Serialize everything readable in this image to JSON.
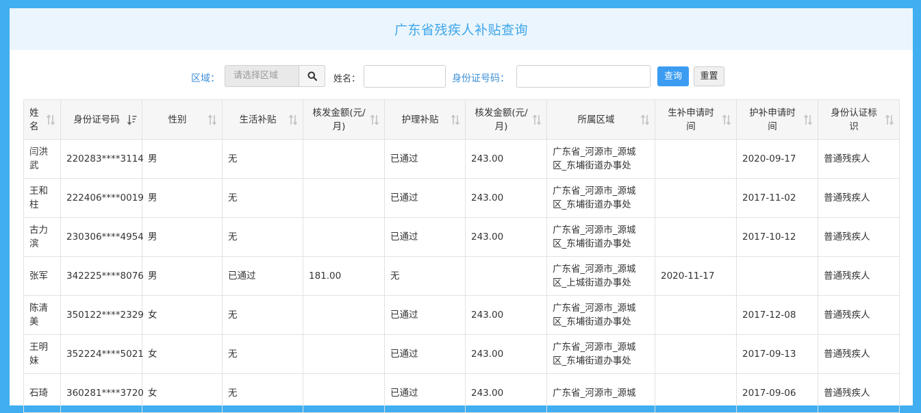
{
  "page": {
    "title": "广东省残疾人补贴查询"
  },
  "search": {
    "area_label": "区域：",
    "area_placeholder": "请选择区域",
    "name_label": "姓名：",
    "name_value": "",
    "id_label": "身份证号码：",
    "id_value": "",
    "query_button": "查询",
    "reset_button": "重置"
  },
  "table": {
    "headers": [
      {
        "line1": "姓",
        "line2": "名",
        "sort": "none"
      },
      {
        "line1": "身份证号码",
        "line2": "",
        "sort": "desc"
      },
      {
        "line1": "性别",
        "line2": "",
        "sort": "none"
      },
      {
        "line1": "生活补贴",
        "line2": "",
        "sort": "none"
      },
      {
        "line1": "核发金额(元/",
        "line2": "月)",
        "sort": "none"
      },
      {
        "line1": "护理补贴",
        "line2": "",
        "sort": "none"
      },
      {
        "line1": "核发金额(元/",
        "line2": "月)",
        "sort": "none"
      },
      {
        "line1": "所属区域",
        "line2": "",
        "sort": "none"
      },
      {
        "line1": "生补申请时",
        "line2": "间",
        "sort": "none"
      },
      {
        "line1": "护补申请时",
        "line2": "间",
        "sort": "none"
      },
      {
        "line1": "身份认证标",
        "line2": "识",
        "sort": "none"
      }
    ],
    "rows": [
      [
        [
          "闫洪",
          "武"
        ],
        [
          "220283****3114"
        ],
        [
          "男"
        ],
        [
          "无"
        ],
        [
          ""
        ],
        [
          "已通过"
        ],
        [
          "243.00"
        ],
        [
          "广东省_河源市_源城",
          "区_东埔街道办事处"
        ],
        [
          ""
        ],
        [
          "2020-09-17"
        ],
        [
          "普通残疾人"
        ]
      ],
      [
        [
          "王和",
          "柱"
        ],
        [
          "222406****0019"
        ],
        [
          "男"
        ],
        [
          "无"
        ],
        [
          ""
        ],
        [
          "已通过"
        ],
        [
          "243.00"
        ],
        [
          "广东省_河源市_源城",
          "区_东埔街道办事处"
        ],
        [
          ""
        ],
        [
          "2017-11-02"
        ],
        [
          "普通残疾人"
        ]
      ],
      [
        [
          "古力",
          "滨"
        ],
        [
          "230306****4954"
        ],
        [
          "男"
        ],
        [
          "无"
        ],
        [
          ""
        ],
        [
          "已通过"
        ],
        [
          "243.00"
        ],
        [
          "广东省_河源市_源城",
          "区_东埔街道办事处"
        ],
        [
          ""
        ],
        [
          "2017-10-12"
        ],
        [
          "普通残疾人"
        ]
      ],
      [
        [
          "张军"
        ],
        [
          "342225****8076"
        ],
        [
          "男"
        ],
        [
          "已通过"
        ],
        [
          "181.00"
        ],
        [
          "无"
        ],
        [
          ""
        ],
        [
          "广东省_河源市_源城",
          "区_上城街道办事处"
        ],
        [
          "2020-11-17"
        ],
        [
          ""
        ],
        [
          "普通残疾人"
        ]
      ],
      [
        [
          "陈清",
          "美"
        ],
        [
          "350122****2329"
        ],
        [
          "女"
        ],
        [
          "无"
        ],
        [
          ""
        ],
        [
          "已通过"
        ],
        [
          "243.00"
        ],
        [
          "广东省_河源市_源城",
          "区_东埔街道办事处"
        ],
        [
          ""
        ],
        [
          "2017-12-08"
        ],
        [
          "普通残疾人"
        ]
      ],
      [
        [
          "王明",
          "妹"
        ],
        [
          "352224****5021"
        ],
        [
          "女"
        ],
        [
          "无"
        ],
        [
          ""
        ],
        [
          "已通过"
        ],
        [
          "243.00"
        ],
        [
          "广东省_河源市_源城",
          "区_东埔街道办事处"
        ],
        [
          ""
        ],
        [
          "2017-09-13"
        ],
        [
          "普通残疾人"
        ]
      ],
      [
        [
          "石琦",
          ""
        ],
        [
          "360281****3720"
        ],
        [
          "女"
        ],
        [
          "无"
        ],
        [
          ""
        ],
        [
          "已通过"
        ],
        [
          "243.00"
        ],
        [
          "广东省_河源市_源城",
          ""
        ],
        [
          ""
        ],
        [
          "2017-09-06"
        ],
        [
          "普通残疾人"
        ]
      ]
    ]
  }
}
